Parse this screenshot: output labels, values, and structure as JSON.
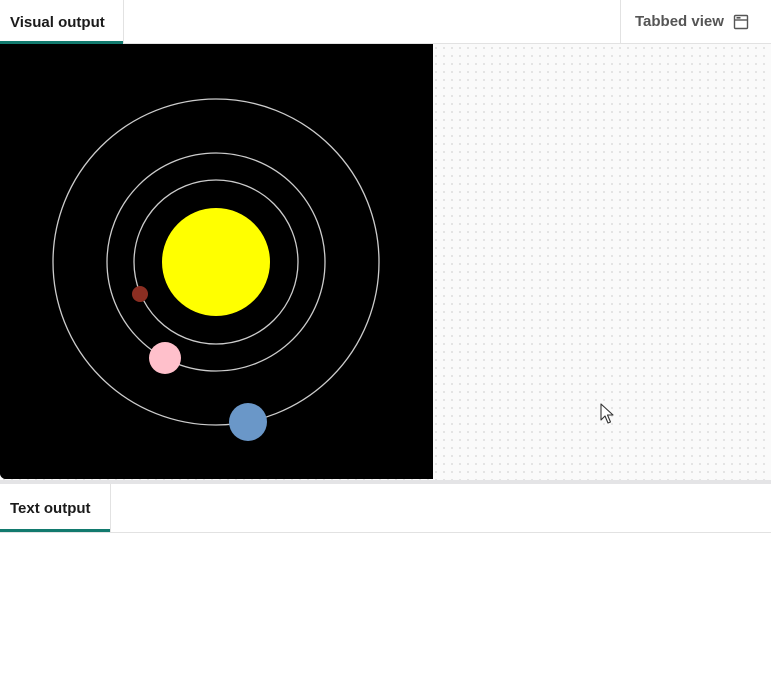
{
  "top_panel": {
    "tab_visual_label": "Visual output",
    "tabbed_view_label": "Tabbed view",
    "tabbed_view_icon": "window-layout-icon"
  },
  "bottom_panel": {
    "tab_text_label": "Text output",
    "text_content": ""
  },
  "canvas": {
    "background": "#000000",
    "orbit_color": "#cccccc",
    "sun": {
      "color": "#ffff00"
    },
    "planets": [
      {
        "name": "",
        "color": "#8b2e22"
      },
      {
        "name": "",
        "color": "#ffc0cb"
      },
      {
        "name": "",
        "color": "#6a97c8"
      }
    ]
  },
  "colors": {
    "accent": "#127a6e",
    "tab_border": "#e2e2e2",
    "splitter": "#e4e4e6"
  }
}
